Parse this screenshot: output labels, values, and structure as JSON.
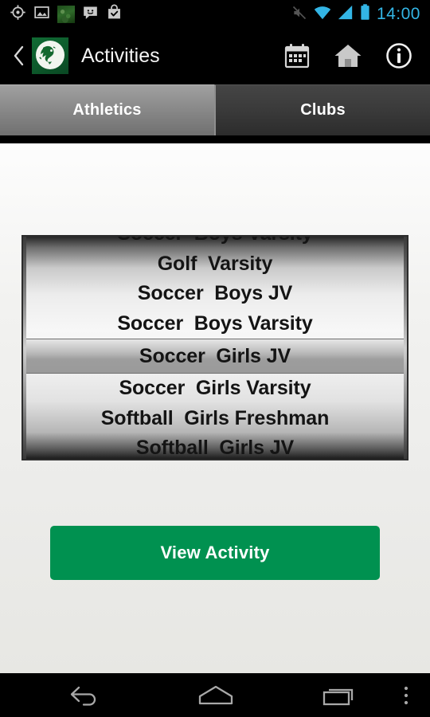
{
  "statusbar": {
    "time": "14:00",
    "left_icons": [
      "gps-location-icon",
      "photo-image-icon",
      "app-thumbnail-icon",
      "chat-smiley-icon",
      "shopping-bag-check-icon"
    ],
    "right_icons": [
      "silent-mute-icon",
      "wifi-icon",
      "cellular-signal-icon",
      "battery-icon"
    ],
    "time_color": "#33b5e5"
  },
  "actionbar": {
    "back_label": "Back",
    "logo_name": "mustang-horse-logo",
    "title": "Activities",
    "actions": [
      {
        "name": "calendar-icon",
        "label": "Calendar"
      },
      {
        "name": "home-icon",
        "label": "Home"
      },
      {
        "name": "info-icon",
        "label": "Info"
      }
    ]
  },
  "tabs": {
    "items": [
      {
        "label": "Athletics",
        "selected": true
      },
      {
        "label": "Clubs",
        "selected": false
      }
    ]
  },
  "picker": {
    "name": "activity-picker",
    "clipped_top_item": "Soccer  Boys Varsity",
    "items": [
      {
        "label": "Golf  Varsity",
        "selected": false
      },
      {
        "label": "Soccer  Boys JV",
        "selected": false
      },
      {
        "label": "Soccer  Boys Varsity",
        "selected": false
      },
      {
        "label": "Soccer  Girls JV",
        "selected": true
      },
      {
        "label": "Soccer  Girls Varsity",
        "selected": false
      },
      {
        "label": "Softball  Girls Freshman",
        "selected": false
      },
      {
        "label": "Softball  Girls JV",
        "selected": false
      }
    ],
    "selected_value": "Soccer  Girls JV"
  },
  "primary_button": {
    "label": "View Activity",
    "color": "#009150"
  },
  "navbar": {
    "buttons": [
      {
        "name": "nav-back-icon",
        "label": "Back"
      },
      {
        "name": "nav-home-icon",
        "label": "Home"
      },
      {
        "name": "nav-recents-icon",
        "label": "Recent apps"
      },
      {
        "name": "nav-overflow-icon",
        "label": "Menu"
      }
    ]
  }
}
